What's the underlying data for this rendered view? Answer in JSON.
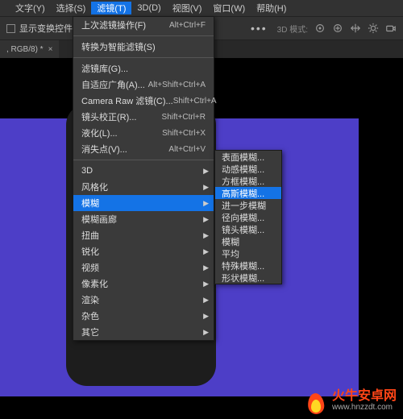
{
  "menubar": [
    "文字(Y)",
    "选择(S)",
    "滤镜(T)",
    "3D(D)",
    "视图(V)",
    "窗口(W)",
    "帮助(H)"
  ],
  "menubar_active_index": 2,
  "optbar": {
    "checkbox_label": "显示变换控件",
    "dots": "•••",
    "mode_label": "3D 模式:"
  },
  "tab": {
    "label": ", RGB/8) *",
    "close": "×"
  },
  "dropdown": [
    {
      "t": "item",
      "label": "上次滤镜操作(F)",
      "shortcut": "Alt+Ctrl+F"
    },
    {
      "t": "sep"
    },
    {
      "t": "item",
      "label": "转换为智能滤镜(S)"
    },
    {
      "t": "sep"
    },
    {
      "t": "item",
      "label": "滤镜库(G)..."
    },
    {
      "t": "item",
      "label": "自适应广角(A)...",
      "shortcut": "Alt+Shift+Ctrl+A"
    },
    {
      "t": "item",
      "label": "Camera Raw 滤镜(C)...",
      "shortcut": "Shift+Ctrl+A"
    },
    {
      "t": "item",
      "label": "镜头校正(R)...",
      "shortcut": "Shift+Ctrl+R"
    },
    {
      "t": "item",
      "label": "液化(L)...",
      "shortcut": "Shift+Ctrl+X"
    },
    {
      "t": "item",
      "label": "消失点(V)...",
      "shortcut": "Alt+Ctrl+V"
    },
    {
      "t": "sep"
    },
    {
      "t": "item",
      "label": "3D",
      "sub": true
    },
    {
      "t": "item",
      "label": "风格化",
      "sub": true
    },
    {
      "t": "item",
      "label": "模糊",
      "sub": true,
      "hl": true
    },
    {
      "t": "item",
      "label": "模糊画廊",
      "sub": true
    },
    {
      "t": "item",
      "label": "扭曲",
      "sub": true
    },
    {
      "t": "item",
      "label": "锐化",
      "sub": true
    },
    {
      "t": "item",
      "label": "视频",
      "sub": true
    },
    {
      "t": "item",
      "label": "像素化",
      "sub": true
    },
    {
      "t": "item",
      "label": "渲染",
      "sub": true
    },
    {
      "t": "item",
      "label": "杂色",
      "sub": true
    },
    {
      "t": "item",
      "label": "其它",
      "sub": true
    }
  ],
  "submenu": [
    {
      "t": "item",
      "label": "表面模糊..."
    },
    {
      "t": "item",
      "label": "动感模糊..."
    },
    {
      "t": "item",
      "label": "方框模糊..."
    },
    {
      "t": "item",
      "label": "高斯模糊...",
      "hl": true
    },
    {
      "t": "item",
      "label": "进一步模糊"
    },
    {
      "t": "item",
      "label": "径向模糊..."
    },
    {
      "t": "item",
      "label": "镜头模糊..."
    },
    {
      "t": "item",
      "label": "模糊"
    },
    {
      "t": "item",
      "label": "平均"
    },
    {
      "t": "item",
      "label": "特殊模糊..."
    },
    {
      "t": "item",
      "label": "形状模糊..."
    }
  ],
  "watermark": {
    "brand": "火牛安卓网",
    "site": "www.hnzzdt.com"
  }
}
